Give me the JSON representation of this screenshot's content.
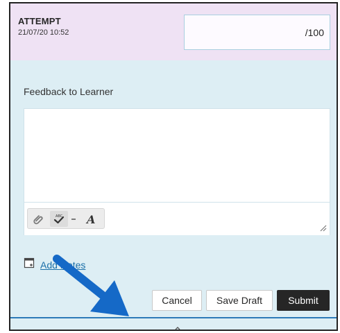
{
  "attempt": {
    "title": "ATTEMPT",
    "datetime": "21/07/20 10:52"
  },
  "grade": {
    "value": "/100"
  },
  "feedback": {
    "label": "Feedback to Learner",
    "text": ""
  },
  "toolbar": {
    "icons": [
      "paperclip-icon",
      "spellcheck-icon",
      "dropdown-caret-icon",
      "text-format-icon",
      "resize-handle-icon"
    ]
  },
  "notes": {
    "link_label": "Add Notes"
  },
  "actions": {
    "cancel_label": "Cancel",
    "save_draft_label": "Save Draft",
    "submit_label": "Submit"
  },
  "colors": {
    "header_bg": "#efe2f4",
    "panel_bg": "#ddeef4",
    "link": "#1a6fa8",
    "submit_bg": "#262626",
    "divider": "#2c7ab8",
    "annotation_arrow": "#1569c7"
  }
}
